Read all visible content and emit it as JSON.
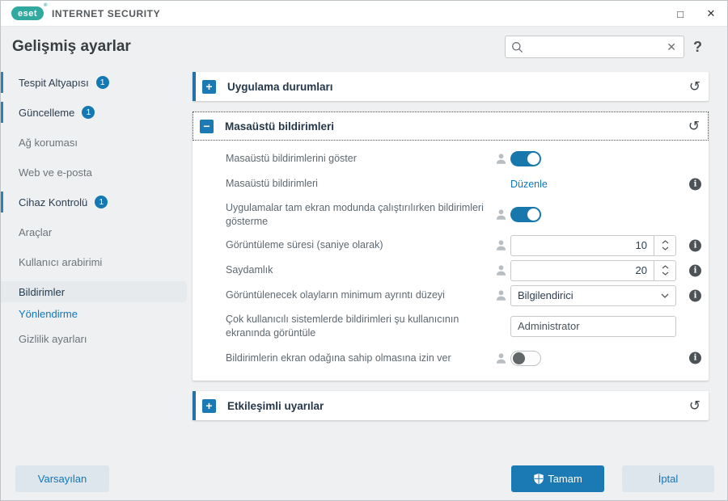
{
  "titlebar": {
    "brand": "eset",
    "product": "INTERNET SECURITY",
    "maximize_icon": "□",
    "close_icon": "✕"
  },
  "header": {
    "title": "Gelişmiş ayarlar",
    "search_value": "",
    "clear_icon": "✕",
    "help_icon": "?"
  },
  "sidebar": {
    "items": [
      {
        "label": "Tespit Altyapısı",
        "badge": "1"
      },
      {
        "label": "Güncelleme",
        "badge": "1"
      },
      {
        "label": "Ağ koruması"
      },
      {
        "label": "Web ve e-posta"
      },
      {
        "label": "Cihaz Kontrolü",
        "badge": "1"
      },
      {
        "label": "Araçlar"
      },
      {
        "label": "Kullanıcı arabirimi"
      },
      {
        "label": "Bildirimler"
      },
      {
        "label": "Yönlendirme"
      },
      {
        "label": "Gizlilik ayarları"
      }
    ]
  },
  "sections": [
    {
      "title": "Uygulama durumları",
      "state": "collapsed",
      "expander_icon": "+"
    },
    {
      "title": "Masaüstü bildirimleri",
      "state": "expanded",
      "expander_icon": "−",
      "rows": [
        {
          "label": "Masaüstü bildirimlerini göster",
          "control": "toggle",
          "value": "on"
        },
        {
          "label": "Masaüstü bildirimleri",
          "control": "link",
          "action": "Düzenle"
        },
        {
          "label": "Uygulamalar tam ekran modunda çalıştırılırken bildirimleri gösterme",
          "control": "toggle",
          "value": "on"
        },
        {
          "label": "Görüntüleme süresi (saniye olarak)",
          "control": "number",
          "value": "10"
        },
        {
          "label": "Saydamlık",
          "control": "number",
          "value": "20"
        },
        {
          "label": "Görüntülenecek olayların minimum ayrıntı düzeyi",
          "control": "select",
          "value": "Bilgilendirici"
        },
        {
          "label": "Çok kullanıcılı sistemlerde bildirimleri şu kullanıcının ekranında görüntüle",
          "control": "text",
          "value": "Administrator"
        },
        {
          "label": "Bildirimlerin ekran odağına sahip olmasına izin ver",
          "control": "toggle",
          "value": "off"
        }
      ]
    },
    {
      "title": "Etkileşimli uyarılar",
      "state": "collapsed",
      "expander_icon": "+"
    }
  ],
  "footer": {
    "default_label": "Varsayılan",
    "ok_label": "Tamam",
    "cancel_label": "İptal"
  },
  "icons": {
    "undo": "↺",
    "search": "magnifier",
    "person": "user-silhouette",
    "info": "i",
    "ok_shield": "security-shield"
  },
  "colors": {
    "brand_teal": "#31a8a0",
    "accent_blue": "#1b79b3",
    "link_blue": "#1076bc",
    "toggle_on": "#1878ac",
    "badge_blue": "#1478b3",
    "sidebar_accent_bar": "#2e81b6"
  }
}
